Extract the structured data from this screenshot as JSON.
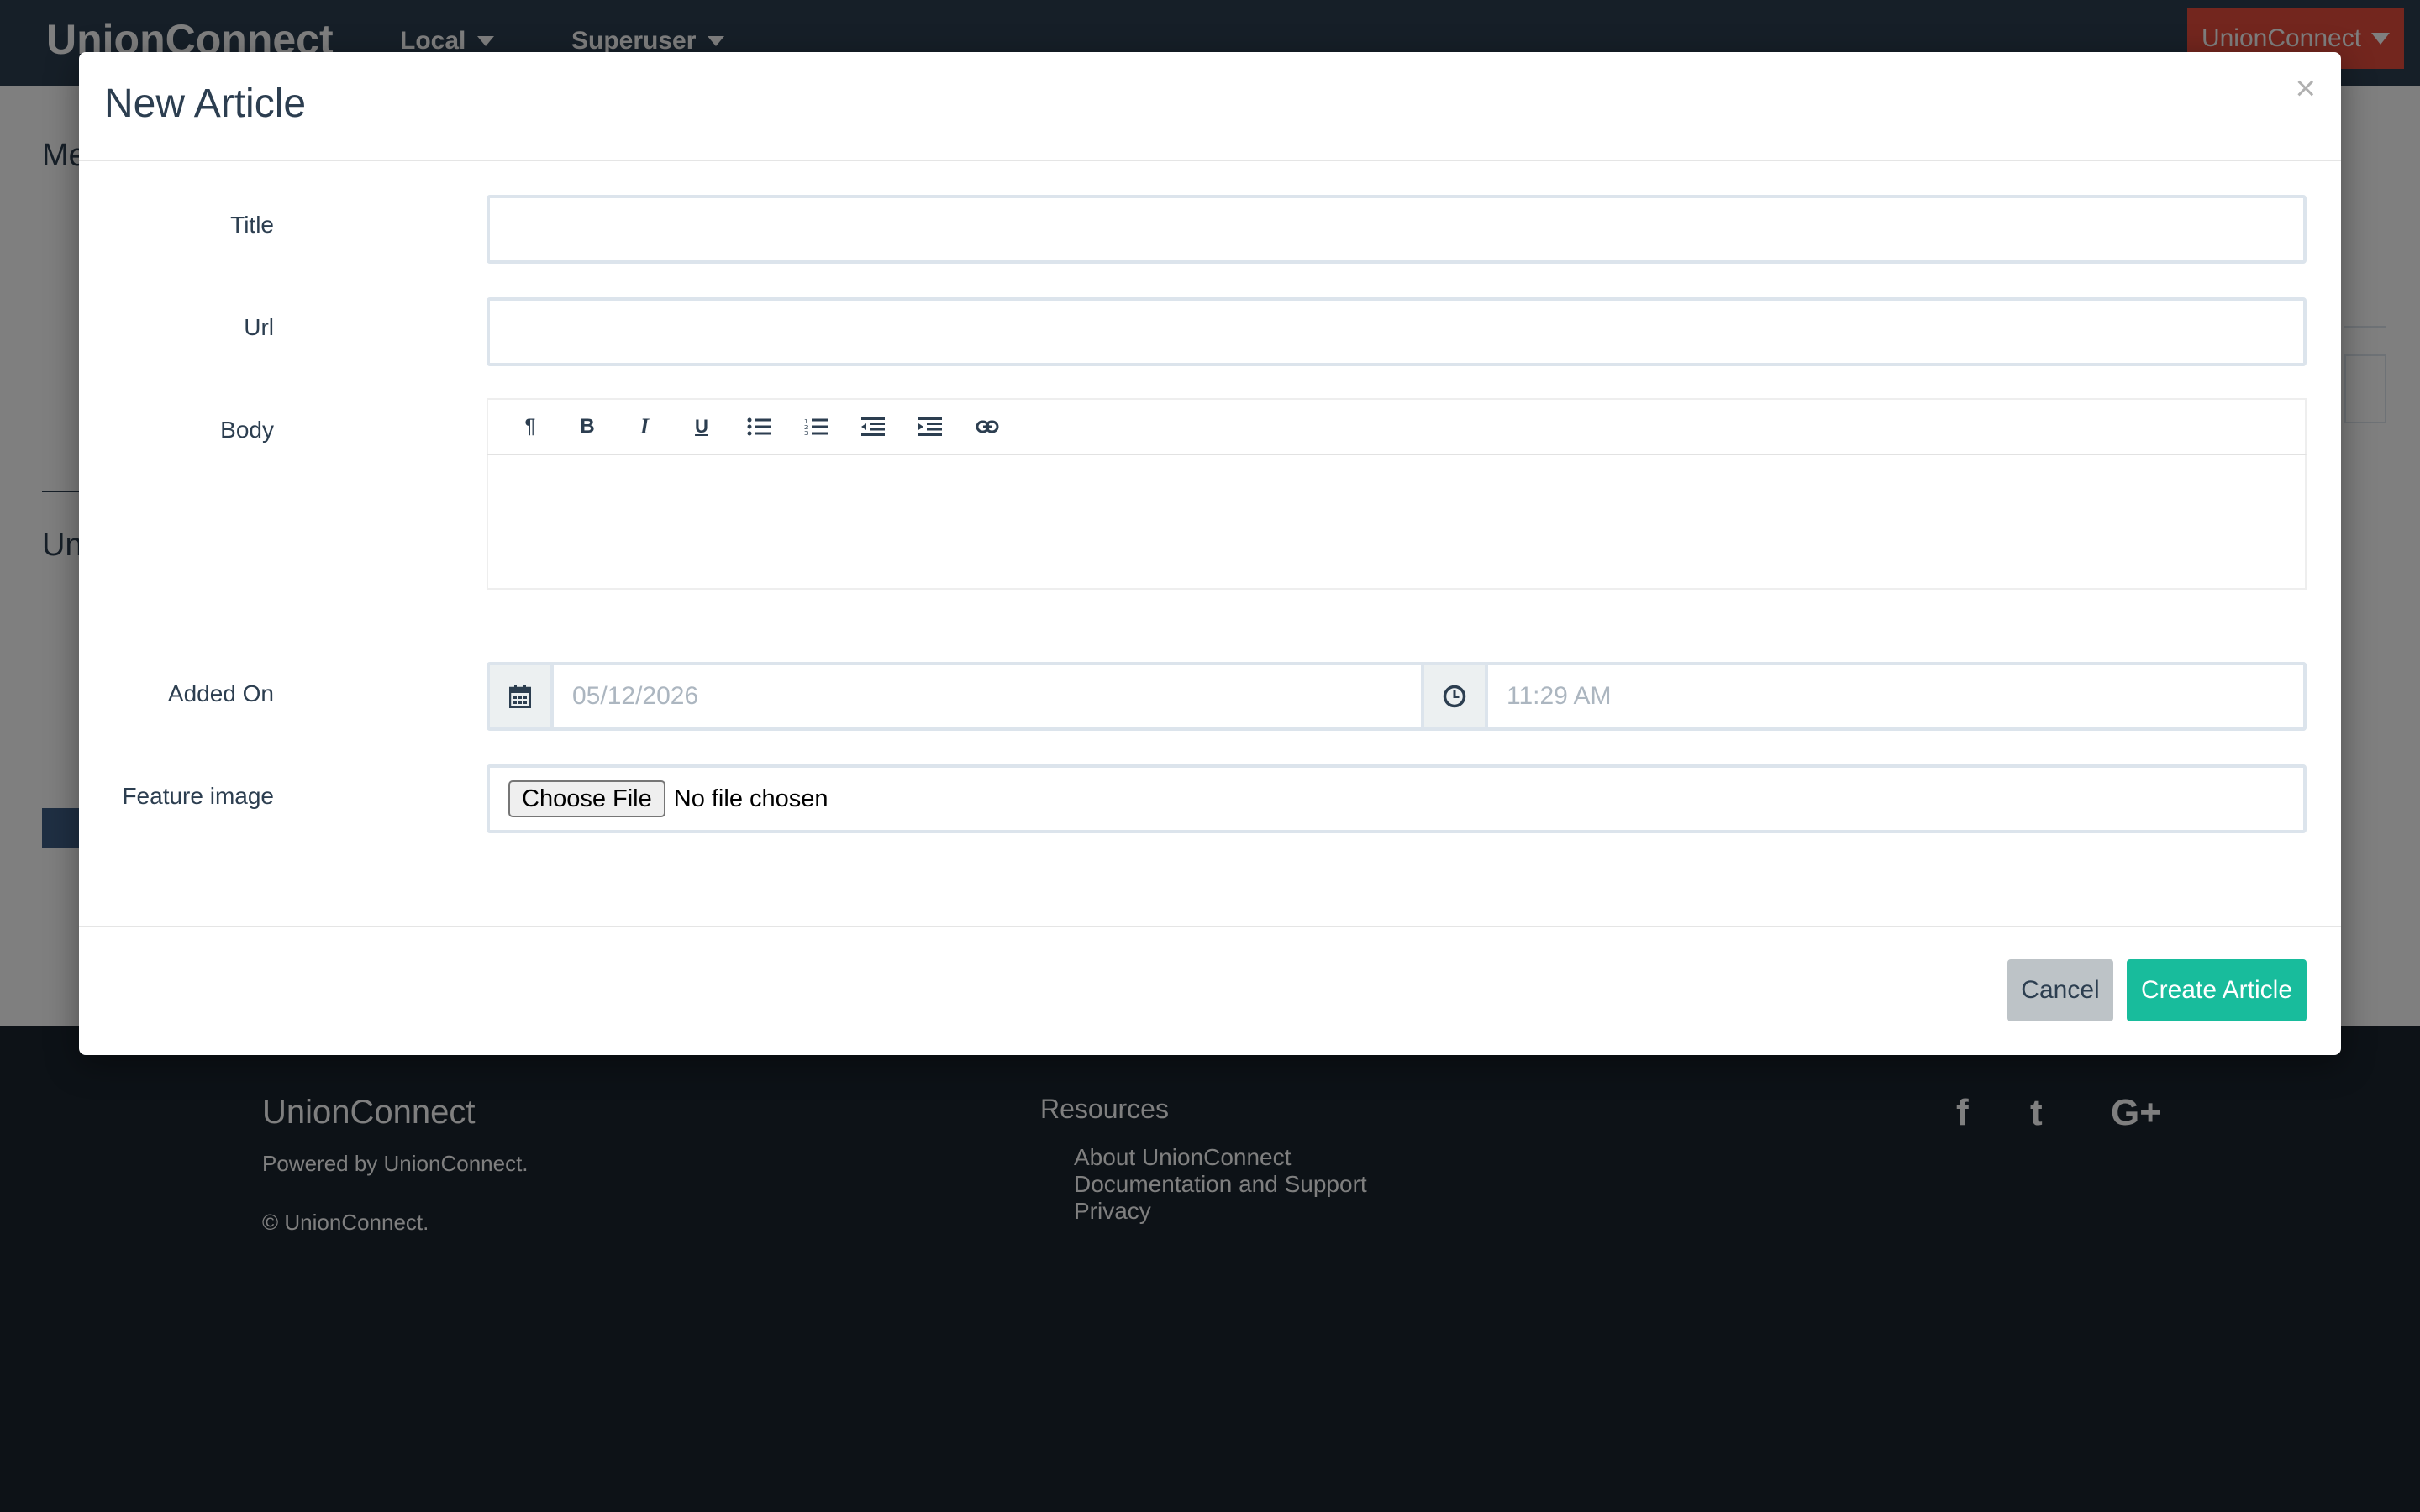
{
  "navbar": {
    "brand": "UnionConnect",
    "items": [
      {
        "label": "Local"
      },
      {
        "label": "Superuser"
      }
    ],
    "user_menu_label": "UnionConnect"
  },
  "background": {
    "heading_1": "Me",
    "heading_2": "Un"
  },
  "footer": {
    "brand": "UnionConnect",
    "powered_by": "Powered by UnionConnect.",
    "copyright": "© UnionConnect.",
    "resources_title": "Resources",
    "links": [
      "About UnionConnect",
      "Documentation and Support",
      "Privacy"
    ],
    "social": {
      "facebook": "f",
      "twitter": "t",
      "googleplus": "G+"
    }
  },
  "modal": {
    "title": "New Article",
    "close": "×",
    "fields": {
      "title": {
        "label": "Title",
        "value": ""
      },
      "url": {
        "label": "Url",
        "value": ""
      },
      "body": {
        "label": "Body",
        "value": ""
      },
      "added_on": {
        "label": "Added On",
        "date_placeholder": "05/12/2026",
        "time_placeholder": "11:29 AM"
      },
      "feature_image": {
        "label": "Feature image",
        "button": "Choose File",
        "status": "No file chosen"
      }
    },
    "toolbar": [
      "paragraph-icon",
      "bold-icon",
      "italic-icon",
      "underline-icon",
      "unordered-list-icon",
      "ordered-list-icon",
      "outdent-icon",
      "indent-icon",
      "link-icon"
    ],
    "buttons": {
      "cancel": "Cancel",
      "create": "Create Article"
    }
  },
  "colors": {
    "primary": "#2c3e50",
    "success": "#18bc9c",
    "danger": "#e74c3c",
    "default": "#bdc3c7"
  }
}
